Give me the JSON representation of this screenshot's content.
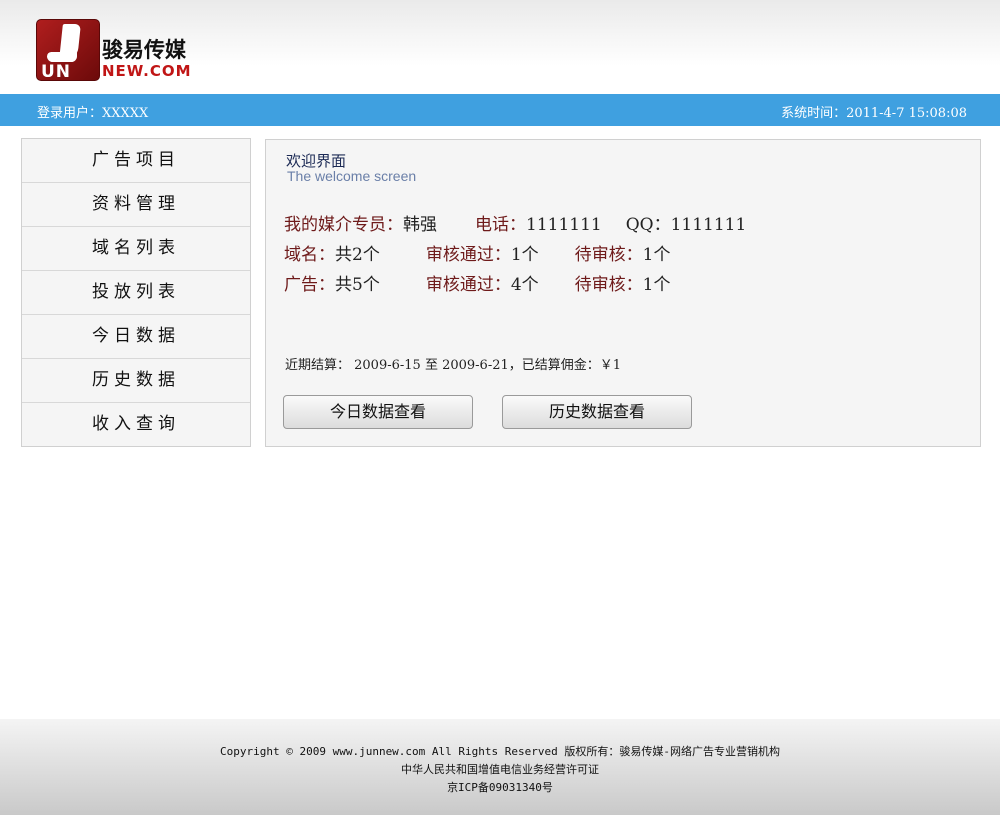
{
  "header": {
    "logo_name": "骏易传媒",
    "logo_mark_text": "UN",
    "logo_domain": "NEW.COM"
  },
  "infobar": {
    "login_user": "登录用户：XXXXX",
    "system_time": "系统时间：2011-4-7 15:08:08"
  },
  "sidebar": {
    "items": [
      {
        "label": "广告项目"
      },
      {
        "label": "资料管理"
      },
      {
        "label": "域名列表"
      },
      {
        "label": "投放列表"
      },
      {
        "label": "今日数据"
      },
      {
        "label": "历史数据"
      },
      {
        "label": "收入查询"
      }
    ]
  },
  "main": {
    "title": "欢迎界面",
    "subtitle": "The welcome screen",
    "specialist_label": "我的媒介专员：",
    "specialist_name": "韩强",
    "phone_label": "电话：",
    "phone_value": "1111111",
    "qq_label": "QQ：",
    "qq_value": "1111111",
    "domain_label": "域名：",
    "domain_total": "共2个",
    "approved_label": "审核通过：",
    "domain_approved": "1个",
    "pending_label": "待审核：",
    "domain_pending": "1个",
    "ad_label": "广告：",
    "ad_total": "共5个",
    "ad_approved": "4个",
    "ad_pending": "1个",
    "settlement": "近期结算： 2009-6-15 至 2009-6-21，已结算佣金：￥1",
    "btn_today": "今日数据查看",
    "btn_history": "历史数据查看"
  },
  "footer": {
    "line1": "Copyright © 2009 www.junnew.com All Rights Reserved  版权所有：骏易传媒-网络广告专业营销机构",
    "line2": "中华人民共和国增值电信业务经营许可证",
    "line3": "京ICP备09031340号"
  }
}
